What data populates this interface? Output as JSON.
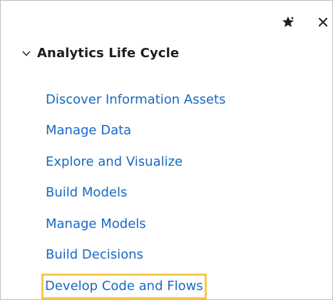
{
  "toolbar": {
    "pin_icon": "pin-star-icon",
    "close_icon": "close-icon"
  },
  "section": {
    "expanded": true,
    "chevron_icon": "chevron-down-icon",
    "title": "Analytics Life Cycle"
  },
  "nav": {
    "items": [
      {
        "label": "Discover Information Assets"
      },
      {
        "label": "Manage Data"
      },
      {
        "label": "Explore and Visualize"
      },
      {
        "label": "Build Models"
      },
      {
        "label": "Manage Models"
      },
      {
        "label": "Build Decisions"
      },
      {
        "label": "Develop Code and Flows",
        "focused": true
      }
    ]
  },
  "colors": {
    "link": "#1769c4",
    "focus_ring": "#f7c948",
    "title": "#1c1e21",
    "border": "#b8bcc2"
  }
}
